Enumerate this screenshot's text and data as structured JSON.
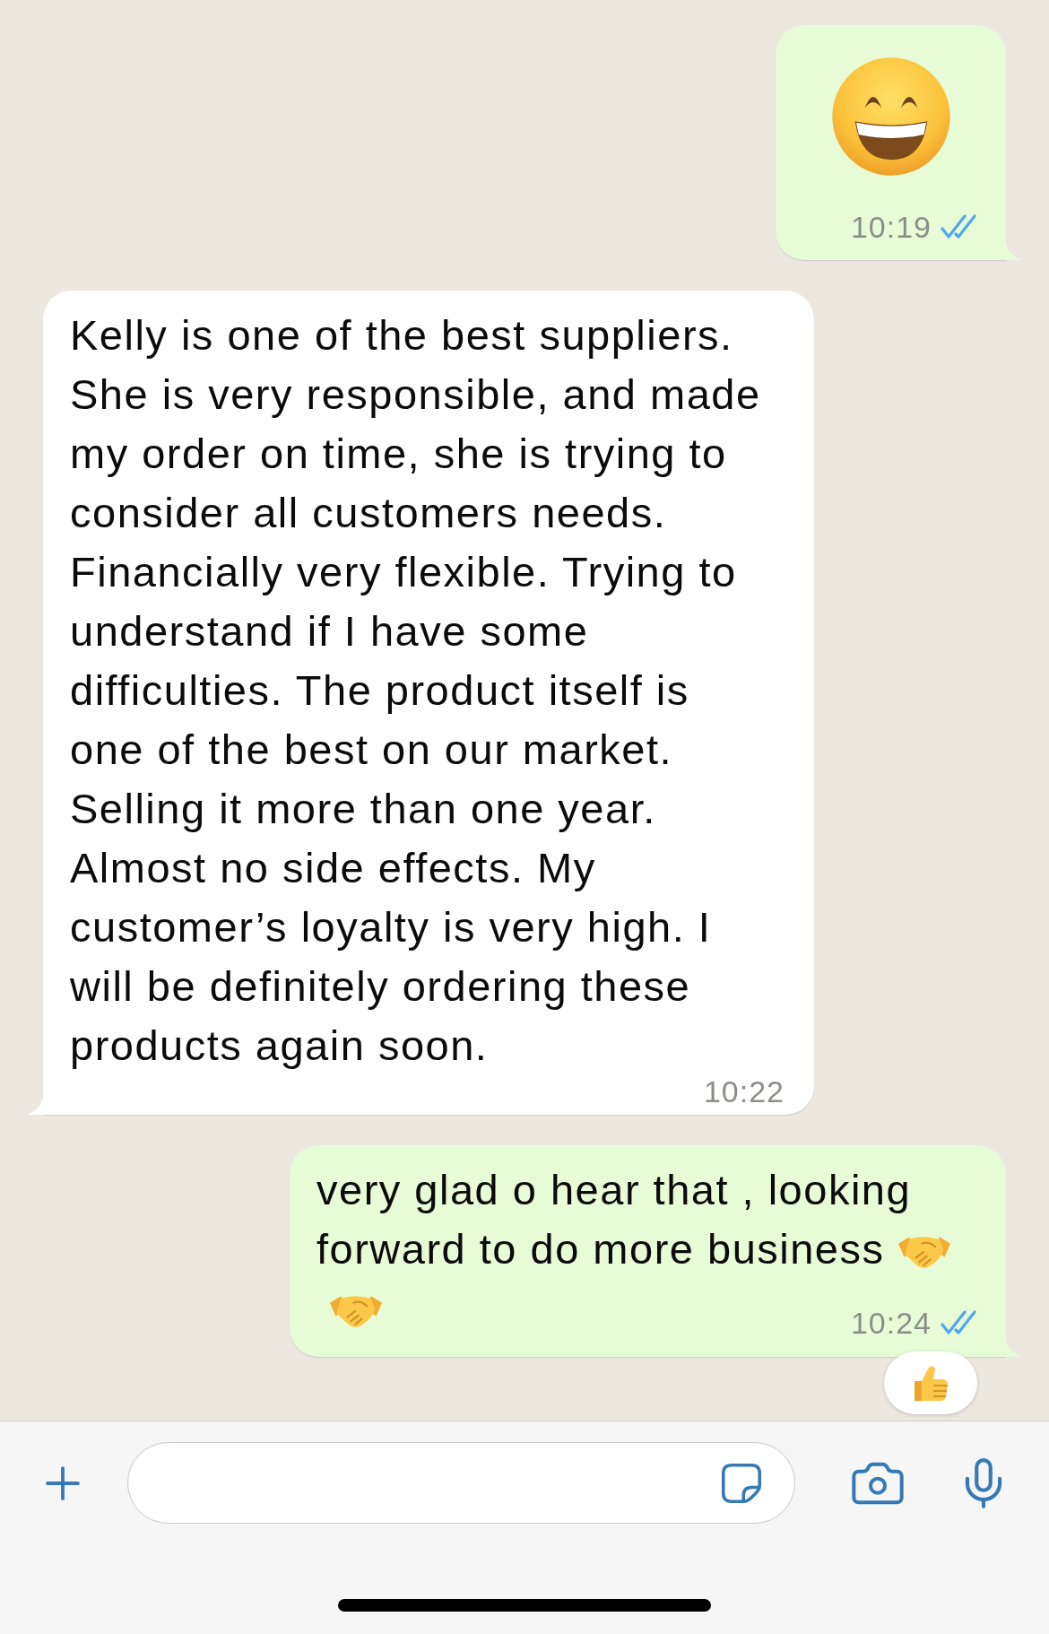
{
  "messages": [
    {
      "kind": "emoji",
      "outgoing": true,
      "time": "10:19",
      "read": true,
      "reacted": false
    },
    {
      "kind": "text",
      "outgoing": false,
      "text": "Kelly is one of the best suppliers. She is very responsible, and made my order on time, she is trying to consider all customers needs. Financially very flexible. Trying to understand if I have some difficulties. The product itself is one of the best on our market. Selling it more than one year. Almost no side effects. My customer’s loyalty is very high. I will be definitely ordering these products again soon.",
      "time": "10:22",
      "reacted": false
    },
    {
      "kind": "text_with_emojis",
      "outgoing": true,
      "text": "very glad o hear that , looking forward to do more business",
      "time": "10:24",
      "read": true,
      "reacted": true
    }
  ]
}
